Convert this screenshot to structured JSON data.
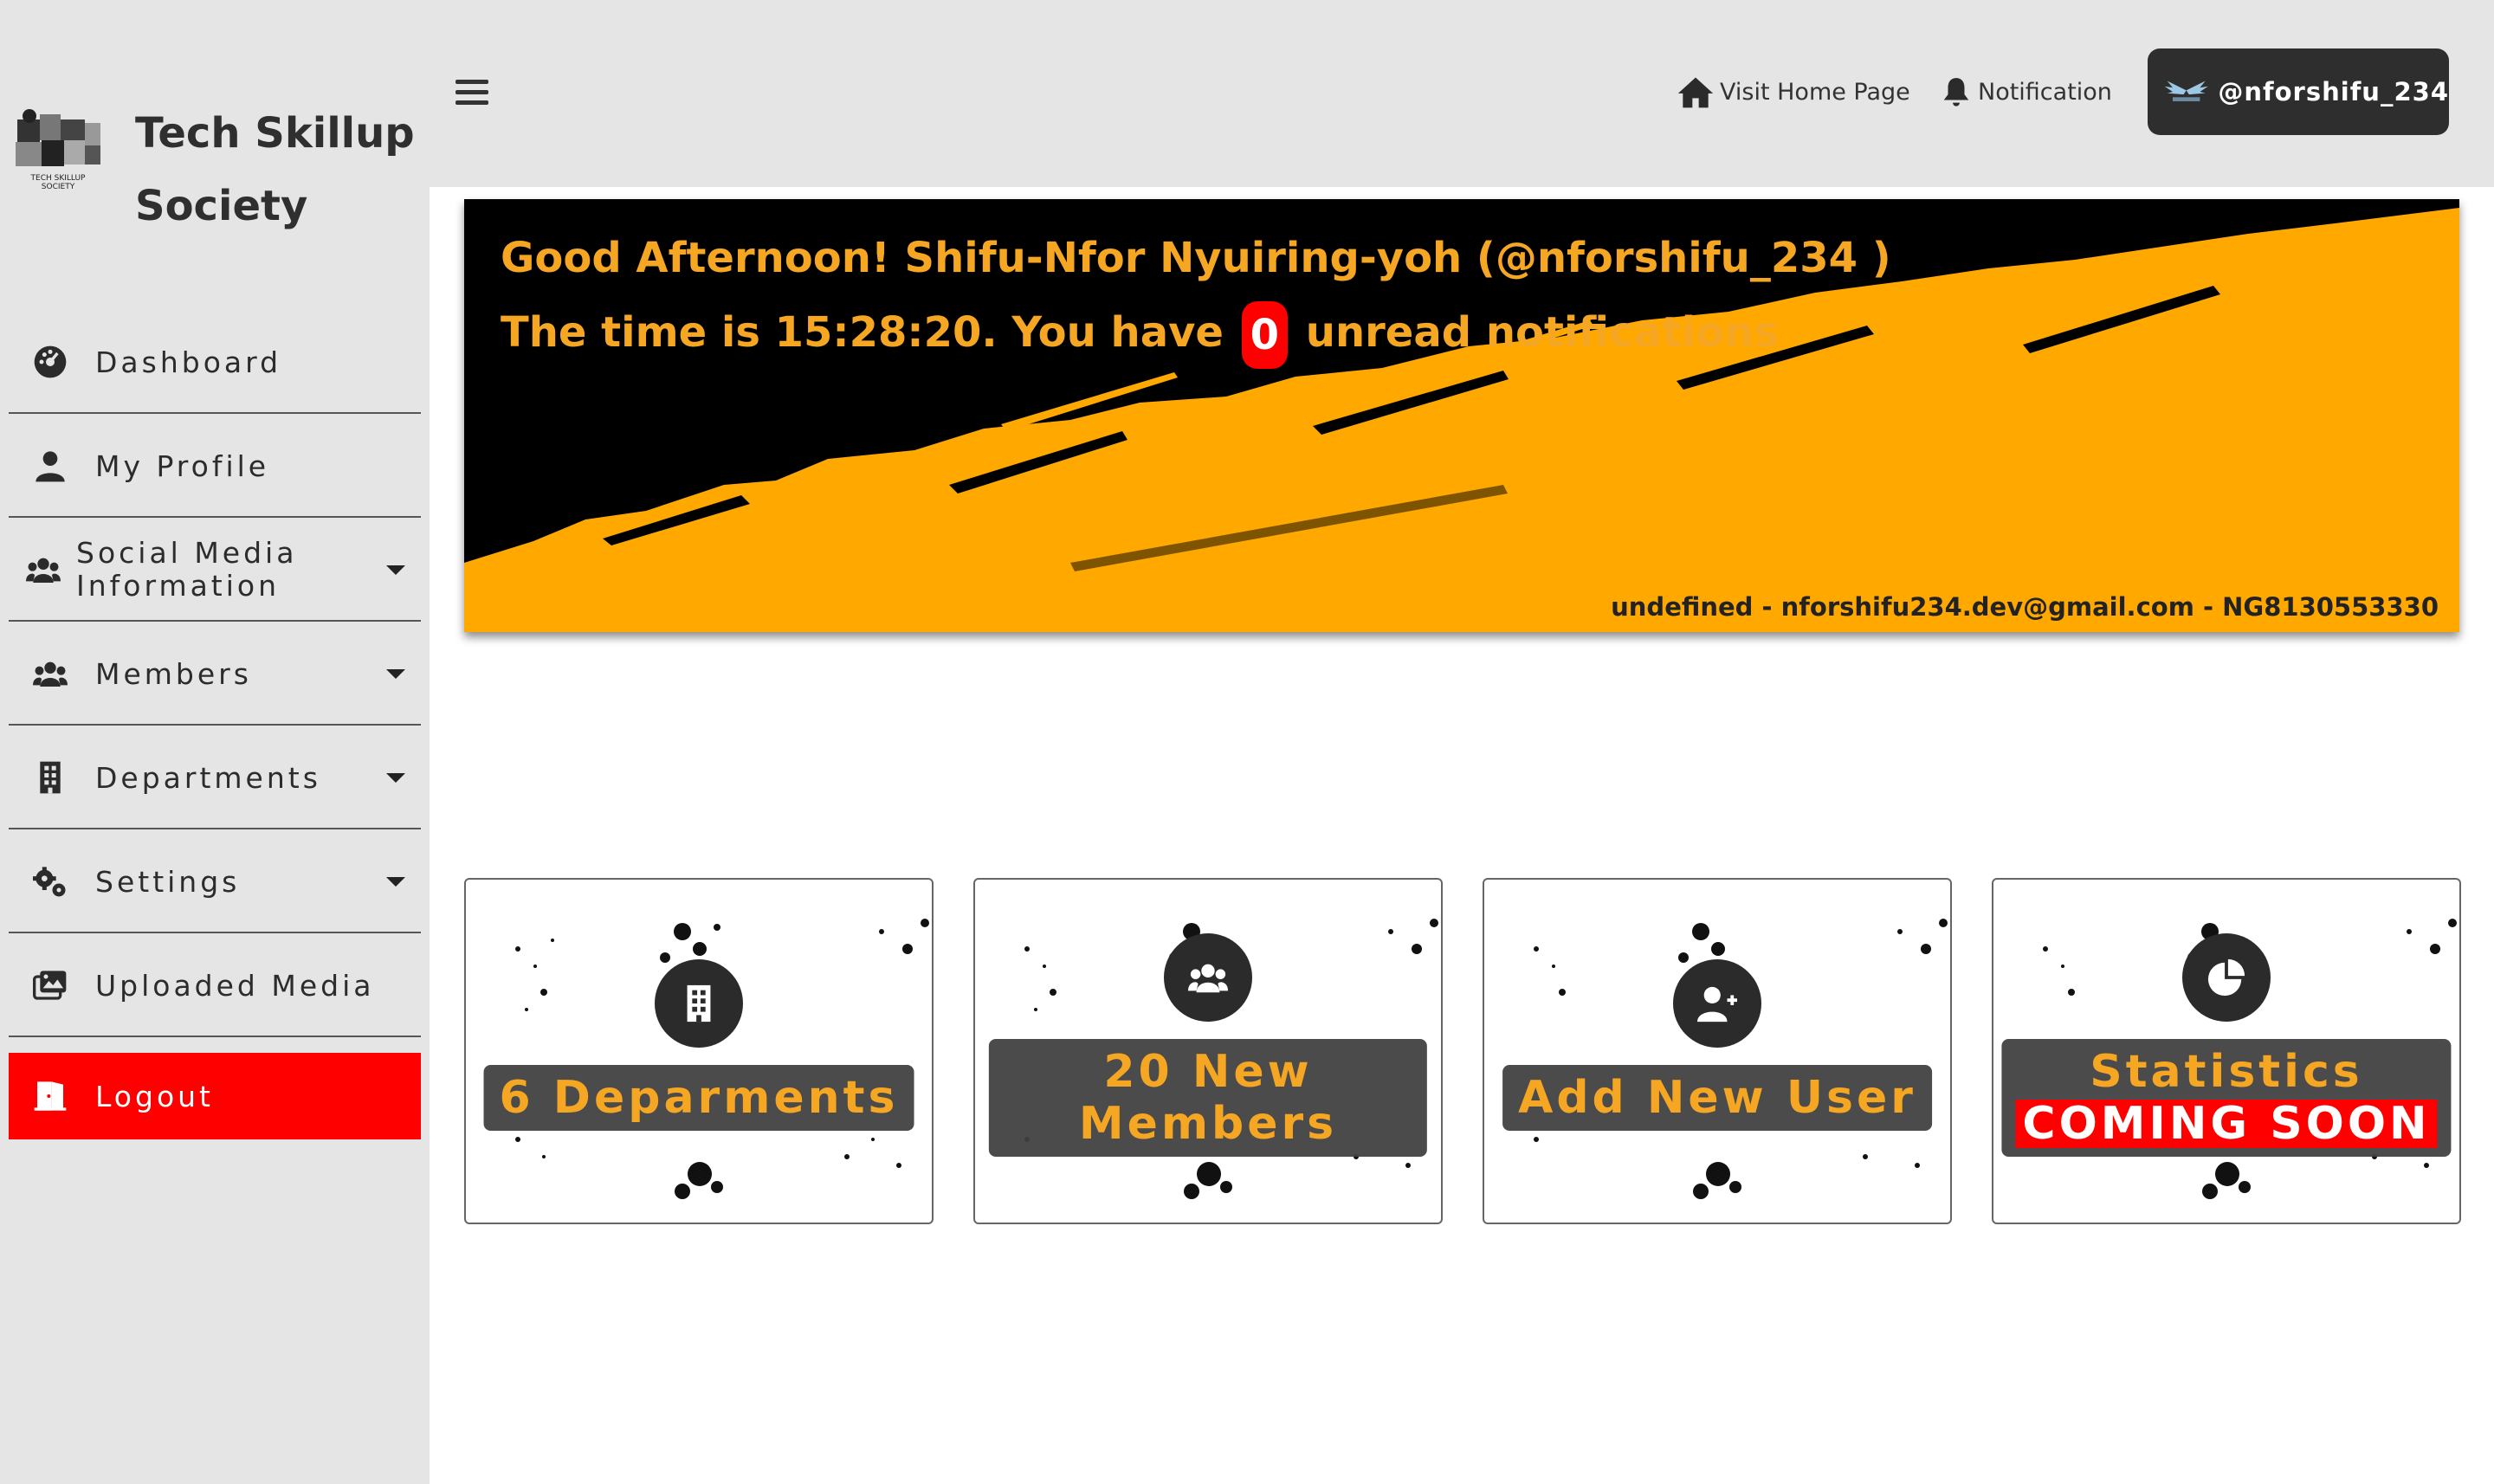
{
  "brand": {
    "title": "Tech Skillup\nSociety",
    "logo_icon": "puzzle-logo-icon"
  },
  "header": {
    "menu_icon": "hamburger-icon",
    "visit_home_label": "Visit Home Page",
    "notification_label": "Notification",
    "username": "@nforshifu_234"
  },
  "sidebar": {
    "items": [
      {
        "label": "Dashboard",
        "icon": "gauge-icon",
        "dropdown": false
      },
      {
        "label": "My Profile",
        "icon": "user-icon",
        "dropdown": false
      },
      {
        "label": "Social Media\nInformation",
        "icon": "users-icon",
        "dropdown": true
      },
      {
        "label": "Members",
        "icon": "users-icon",
        "dropdown": true
      },
      {
        "label": "Departments",
        "icon": "building-icon",
        "dropdown": true
      },
      {
        "label": "Settings",
        "icon": "gears-icon",
        "dropdown": true
      },
      {
        "label": "Uploaded Media",
        "icon": "images-icon",
        "dropdown": false
      },
      {
        "label": "Logout",
        "icon": "door-exit-icon",
        "dropdown": false
      }
    ]
  },
  "banner": {
    "greeting": "Good Afternoon! Shifu-Nfor Nyuiring-yoh (@nforshifu_234 )",
    "time_prefix": "The time is 15:28:20. You have",
    "unread_count": "0",
    "time_suffix": "unread notifications",
    "footer": "undefined - nforshifu234.dev@gmail.com - NG8130553330"
  },
  "cards": [
    {
      "label": "6 Deparments",
      "icon": "building-icon"
    },
    {
      "label_line1": "20 New",
      "label_line2": "Members",
      "icon": "users-icon"
    },
    {
      "label": "Add New User",
      "icon": "user-plus-icon"
    },
    {
      "label_line1": "Statistics",
      "label_line2": "COMING SOON",
      "icon": "pie-chart-icon"
    }
  ],
  "colors": {
    "accent": "#f5a623",
    "logout_bg": "#ff0000",
    "banner_bg": "#000000",
    "chip_bg": "#2e2e2e",
    "sidebar_bg": "#e6e5e6"
  }
}
